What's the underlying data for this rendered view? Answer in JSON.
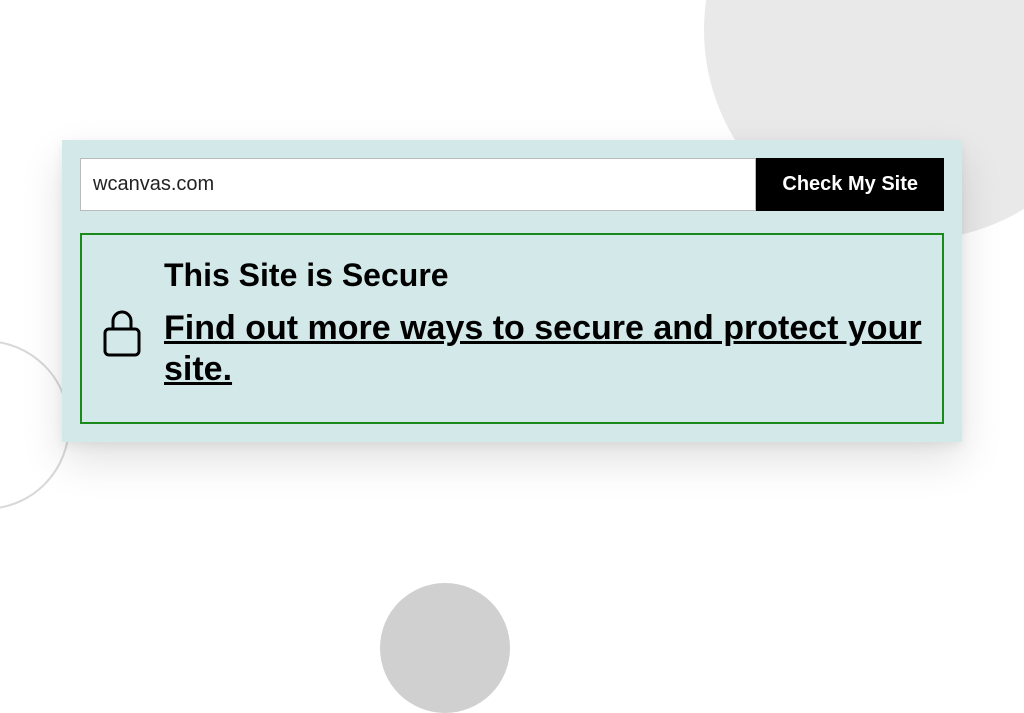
{
  "checker": {
    "input_value": "wcanvas.com",
    "button_label": "Check My Site"
  },
  "result": {
    "heading": "This Site is Secure",
    "link_text": "Find out more ways to secure and protect your site."
  }
}
